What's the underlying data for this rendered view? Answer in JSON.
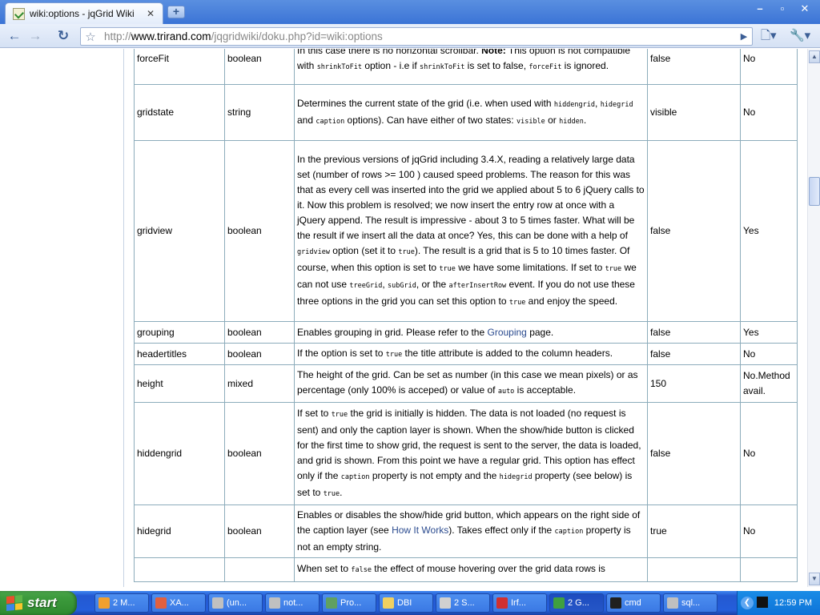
{
  "browser": {
    "tab_title": "wiki:options - jqGrid Wiki",
    "tab_close": "✕",
    "new_tab": "+",
    "window_buttons": [
      "–",
      "▫",
      "✕"
    ],
    "url_prefix": "http://",
    "url_host": "www.trirand.com",
    "url_path": "/jqgridwiki/doku.php?id=wiki:options"
  },
  "table": {
    "rows": [
      {
        "name": "forceFit",
        "type": "boolean",
        "desc_parts": [
          "In this case there is no horizontal scrollbar. ",
          "Note:",
          " This option is not compatible with ",
          "shrinkToFit",
          " option - i.e if ",
          "shrinkToFit",
          " is set to false, ",
          "forceFit",
          " is ignored."
        ],
        "default": "false",
        "can_change": "No"
      },
      {
        "name": "gridstate",
        "type": "string",
        "desc_parts": [
          "Determines the current state of the grid (i.e. when used with ",
          "hiddengrid",
          ", ",
          "hidegrid",
          " and ",
          "caption",
          " options). Can have either of two states: ",
          "visible",
          " or ",
          "hidden",
          "."
        ],
        "default": "visible",
        "can_change": "No"
      },
      {
        "name": "gridview",
        "type": "boolean",
        "desc_parts": [
          "In the previous versions of jqGrid including 3.4.X, reading a relatively large data set (number of rows >= 100 ) caused speed problems. The reason for this was that as every cell was inserted into the grid we applied about 5 to 6 jQuery calls to it. Now this problem is resolved; we now insert the entry row at once with a jQuery append. The result is impressive - about 3 to 5 times faster. What will be the result if we insert all the data at once? Yes, this can be done with a help of ",
          "gridview",
          " option (set it to ",
          "true",
          "). The result is a grid that is 5 to 10 times faster. Of course, when this option is set to ",
          "true",
          " we have some limitations. If set to ",
          "true",
          " we can not use ",
          "treeGrid",
          ", ",
          "subGrid",
          ", or the ",
          "afterInsertRow",
          " event. If you do not use these three options in the grid you can set this option to ",
          "true",
          " and enjoy the speed."
        ],
        "default": "false",
        "can_change": "Yes"
      },
      {
        "name": "grouping",
        "type": "boolean",
        "desc_parts": [
          "Enables grouping in grid. Please refer to the ",
          "Grouping",
          " page."
        ],
        "default": "false",
        "can_change": "Yes"
      },
      {
        "name": "headertitles",
        "type": "boolean",
        "desc_parts": [
          "If the option is set to ",
          "true",
          " the title attribute is added to the column headers."
        ],
        "default": "false",
        "can_change": "No"
      },
      {
        "name": "height",
        "type": "mixed",
        "desc_parts": [
          "The height of the grid. Can be set as number (in this case we mean pixels) or as percentage (only 100% is acceped) or value of ",
          "auto",
          " is acceptable."
        ],
        "default": "150",
        "can_change": "No.Method avail."
      },
      {
        "name": "hiddengrid",
        "type": "boolean",
        "desc_parts": [
          "If set to ",
          "true",
          " the grid is initially is hidden. The data is not loaded (no request is sent) and only the caption layer is shown. When the show/hide button is clicked for the first time to show grid, the request is sent to the server, the data is loaded, and grid is shown. From this point we have a regular grid. This option has effect only if the ",
          "caption",
          " property is not empty and the ",
          "hidegrid",
          " property (see below) is set to ",
          "true",
          "."
        ],
        "default": "false",
        "can_change": "No"
      },
      {
        "name": "hidegrid",
        "type": "boolean",
        "desc_parts": [
          "Enables or disables the show/hide grid button, which appears on the right side of the caption layer (see ",
          "How It Works",
          "). Takes effect only if the ",
          "caption",
          " property is not an empty string."
        ],
        "default": "true",
        "can_change": "No"
      },
      {
        "name": "",
        "type": "",
        "desc_parts": [
          "When set to ",
          "false",
          " the effect of mouse hovering over the grid data rows is"
        ],
        "default": "",
        "can_change": ""
      }
    ]
  },
  "taskbar": {
    "start_label": "start",
    "items": [
      {
        "label": "2 M...",
        "icon_color": "#f0a030"
      },
      {
        "label": "XA...",
        "icon_color": "#e06040"
      },
      {
        "label": "(un...",
        "icon_color": "#c0c0c0"
      },
      {
        "label": "not...",
        "icon_color": "#c0c0c0"
      },
      {
        "label": "Pro...",
        "icon_color": "#60a060"
      },
      {
        "label": "DBI",
        "icon_color": "#f0d060"
      },
      {
        "label": "2 S...",
        "icon_color": "#d0d0d0"
      },
      {
        "label": "Irf...",
        "icon_color": "#d03030"
      },
      {
        "label": "2 G...",
        "icon_color": "#40a040"
      },
      {
        "label": "cmd",
        "icon_color": "#202020"
      },
      {
        "label": "sql...",
        "icon_color": "#c0c0c0"
      }
    ],
    "active_index": 8,
    "clock": "12:59 PM"
  }
}
